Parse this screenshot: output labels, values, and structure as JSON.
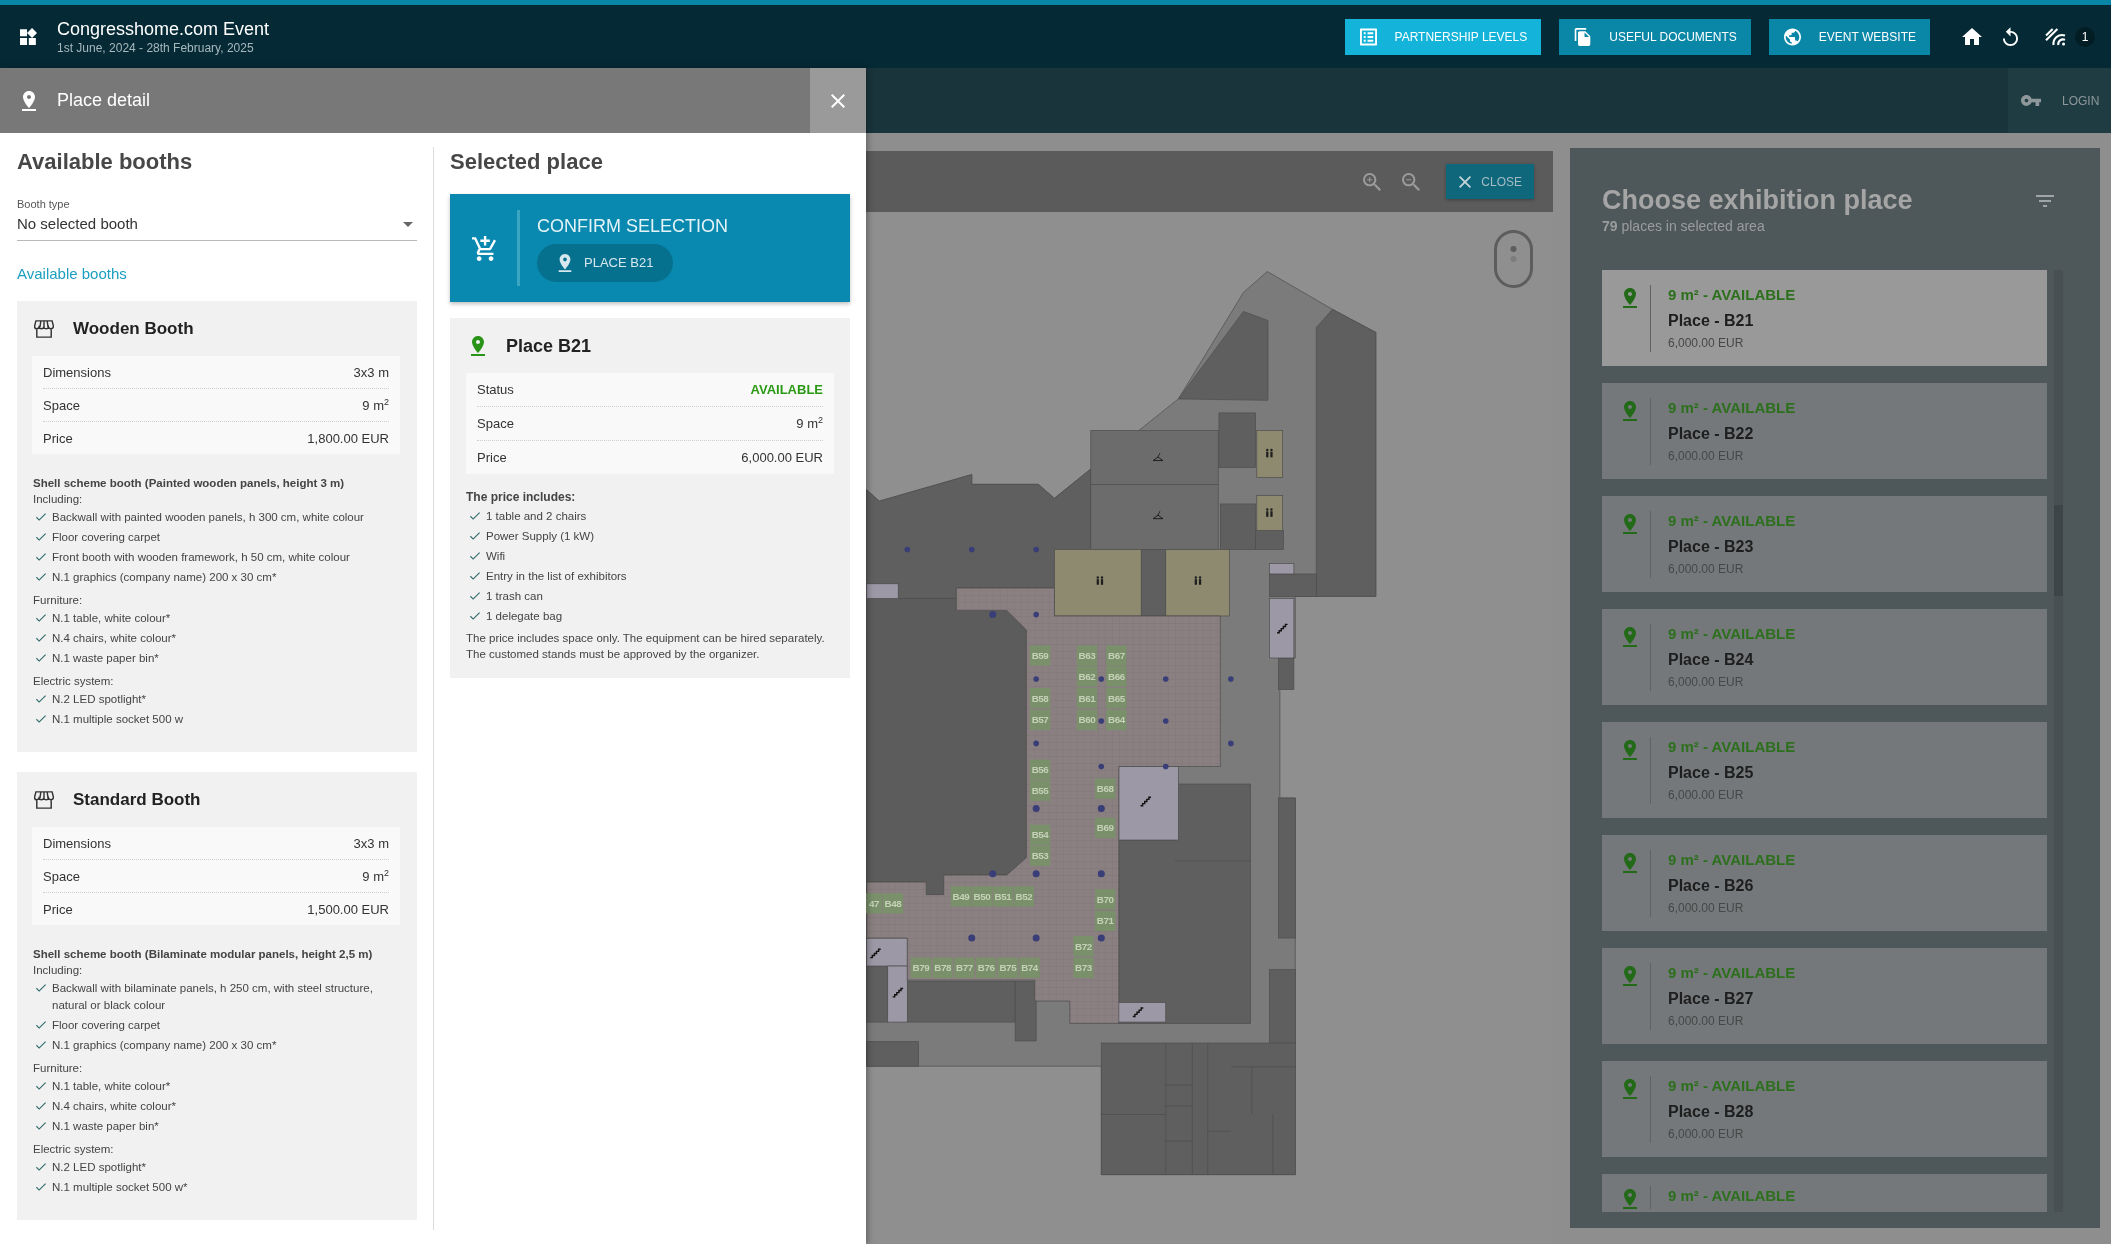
{
  "header": {
    "title": "Congresshome.com Event",
    "dates": "1st June, 2024 - 28th February, 2025",
    "buttons": [
      {
        "label": "PARTNERSHIP LEVELS",
        "highlighted": true
      },
      {
        "label": "USEFUL DOCUMENTS",
        "highlighted": false
      },
      {
        "label": "EVENT WEBSITE",
        "highlighted": false
      }
    ],
    "notification_count": "1"
  },
  "login": {
    "label": "LOGIN"
  },
  "place_detail": {
    "title": "Place detail",
    "available_booths": {
      "heading": "Available booths",
      "booth_type": {
        "label": "Booth type",
        "value": "No selected booth"
      },
      "link": "Available booths",
      "booths": [
        {
          "name": "Wooden Booth",
          "specs": [
            {
              "label": "Dimensions",
              "value": "3x3 m"
            },
            {
              "label": "Space",
              "value": "9 m$^{2}$"
            },
            {
              "label": "Price",
              "value": "1,800.00 EUR"
            }
          ],
          "description": "Shell scheme booth (Painted wooden panels, height 3 m)",
          "sections": [
            {
              "title": "Including:",
              "items": [
                "Backwall with painted wooden panels, h 300 cm, white colour",
                "Floor covering carpet",
                "Front booth with wooden framework, h 50 cm, white colour",
                "N.1 graphics (company name) 200 x 30 cm*"
              ]
            },
            {
              "title": "Furniture:",
              "items": [
                "N.1 table, white colour*",
                "N.4 chairs, white colour*",
                "N.1 waste paper bin*"
              ]
            },
            {
              "title": "Electric system:",
              "items": [
                "N.2 LED spotlight*",
                "N.1 multiple socket 500 w"
              ]
            }
          ]
        },
        {
          "name": "Standard Booth",
          "specs": [
            {
              "label": "Dimensions",
              "value": "3x3 m"
            },
            {
              "label": "Space",
              "value": "9 m$^{2}$"
            },
            {
              "label": "Price",
              "value": "1,500.00 EUR"
            }
          ],
          "description": "Shell scheme booth (Bilaminate modular panels, height 2,5 m)",
          "sections": [
            {
              "title": "Including:",
              "items": [
                "Backwall with bilaminate panels, h 250 cm, with steel structure, natural or black colour",
                "Floor covering carpet",
                "N.1 graphics (company name) 200 x 30 cm*"
              ]
            },
            {
              "title": "Furniture:",
              "items": [
                "N.1 table, white colour*",
                "N.4 chairs, white colour*",
                "N.1 waste paper bin*"
              ]
            },
            {
              "title": "Electric system:",
              "items": [
                "N.2 LED spotlight*",
                "N.1 multiple socket 500 w*"
              ]
            }
          ]
        }
      ]
    },
    "selected_place": {
      "heading": "Selected place",
      "confirm": {
        "label": "CONFIRM SELECTION",
        "chip": "PLACE B21"
      },
      "place": {
        "name": "Place B21",
        "specs": [
          {
            "label": "Status",
            "value": "AVAILABLE",
            "kind": "status"
          },
          {
            "label": "Space",
            "value": "9 m$^{2}$",
            "kind": "text"
          },
          {
            "label": "Price",
            "value": "6,000.00 EUR",
            "kind": "text"
          }
        ],
        "includes_title": "The price includes:",
        "includes": [
          "1 table and 2 chairs",
          "Power Supply (1 kW)",
          "Wifi",
          "Entry in the list of exhibitors",
          "1 trash can",
          "1 delegate bag"
        ],
        "note": "The price includes space only. The equipment can be hired separately. The customed stands must be approved by the organizer."
      }
    }
  },
  "map": {
    "close_label": "CLOSE",
    "booths": [
      "B59",
      "B63",
      "B67",
      "B62",
      "B66",
      "B58",
      "B61",
      "B65",
      "B57",
      "B60",
      "B64",
      "B56",
      "B55",
      "B68",
      "B54",
      "B69",
      "B53",
      "47",
      "B48",
      "B49",
      "B50",
      "B51",
      "B52",
      "B70",
      "B71",
      "B72",
      "B79",
      "B78",
      "B77",
      "B76",
      "B75",
      "B74",
      "B73"
    ]
  },
  "exhibition_places": {
    "title": "Choose exhibition place",
    "summary": "**79** places in selected area",
    "places": [
      {
        "status": "9 m² - AVAILABLE",
        "name": "Place - B21",
        "price": "6,000.00 EUR",
        "selected": true
      },
      {
        "status": "9 m² - AVAILABLE",
        "name": "Place - B22",
        "price": "6,000.00 EUR",
        "selected": false
      },
      {
        "status": "9 m² - AVAILABLE",
        "name": "Place - B23",
        "price": "6,000.00 EUR",
        "selected": false
      },
      {
        "status": "9 m² - AVAILABLE",
        "name": "Place - B24",
        "price": "6,000.00 EUR",
        "selected": false
      },
      {
        "status": "9 m² - AVAILABLE",
        "name": "Place - B25",
        "price": "6,000.00 EUR",
        "selected": false
      },
      {
        "status": "9 m² - AVAILABLE",
        "name": "Place - B26",
        "price": "6,000.00 EUR",
        "selected": false
      },
      {
        "status": "9 m² - AVAILABLE",
        "name": "Place - B27",
        "price": "6,000.00 EUR",
        "selected": false
      },
      {
        "status": "9 m² - AVAILABLE",
        "name": "Place - B28",
        "price": "6,000.00 EUR",
        "selected": false
      },
      {
        "status": "9 m² - AVAILABLE",
        "selected": false
      }
    ]
  }
}
